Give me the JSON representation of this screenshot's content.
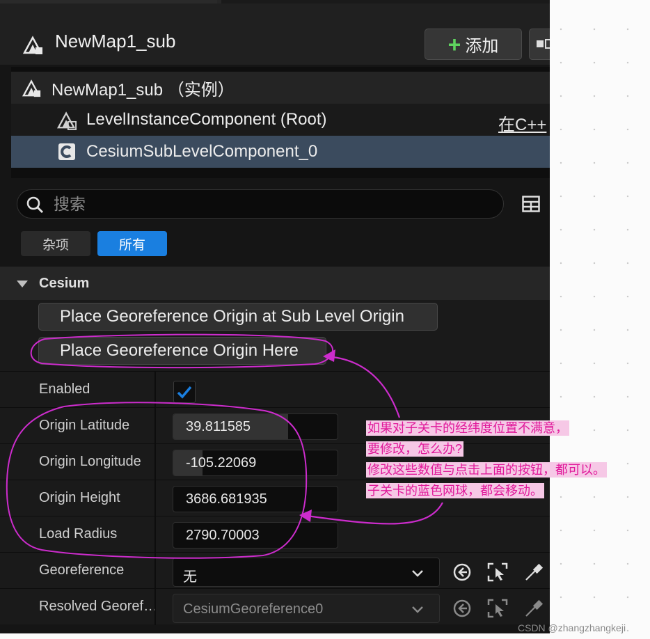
{
  "header": {
    "title": "NewMap1_sub",
    "add_label": "添加"
  },
  "tree": {
    "root_label": "NewMap1_sub （实例）",
    "level_instance_label": "LevelInstanceComponent (Root)",
    "cpp_link": "在C++",
    "selected_label": "CesiumSubLevelComponent_0"
  },
  "search": {
    "placeholder": "搜索"
  },
  "filters": {
    "misc": "杂项",
    "all": "所有"
  },
  "category": {
    "label": "Cesium"
  },
  "buttons": {
    "place_at_sublevel": "Place Georeference Origin at Sub Level Origin",
    "place_here": "Place Georeference Origin Here"
  },
  "properties": {
    "enabled": {
      "label": "Enabled",
      "checked": true
    },
    "origin_latitude": {
      "label": "Origin Latitude",
      "value": "39.811585",
      "fill": 0.7
    },
    "origin_longitude": {
      "label": "Origin Longitude",
      "value": "-105.22069",
      "fill": 0.18
    },
    "origin_height": {
      "label": "Origin Height",
      "value": "3686.681935",
      "fill": 0.0
    },
    "load_radius": {
      "label": "Load Radius",
      "value": "2790.70003",
      "fill": 0.0
    },
    "georeference": {
      "label": "Georeference",
      "value": "无"
    },
    "resolved_georeference": {
      "label": "Resolved Georef…",
      "value": "CesiumGeoreference0"
    }
  },
  "annotation": {
    "line1": "如果对子关卡的经纬度位置不满意，",
    "line2": "要修改，怎么办?",
    "line3": "修改这些数值与点击上面的按钮，都可以。",
    "line4": "子关卡的蓝色网球，都会移动。",
    "color": "#e0199a",
    "highlight": "#f6c8e6"
  },
  "watermark": "CSDN @zhangzhangkeji",
  "colors": {
    "accent": "#1a7fe0",
    "selection": "#3b4b5e",
    "add_plus": "#5fd35f"
  },
  "icons": [
    "actor-icon",
    "level-instance-icon",
    "component-icon",
    "search-icon",
    "grid-icon",
    "caret-down-icon",
    "checkmark-icon",
    "chevron-down-icon",
    "browse-to-icon",
    "use-selected-icon",
    "eyedropper-icon",
    "plus-icon"
  ]
}
